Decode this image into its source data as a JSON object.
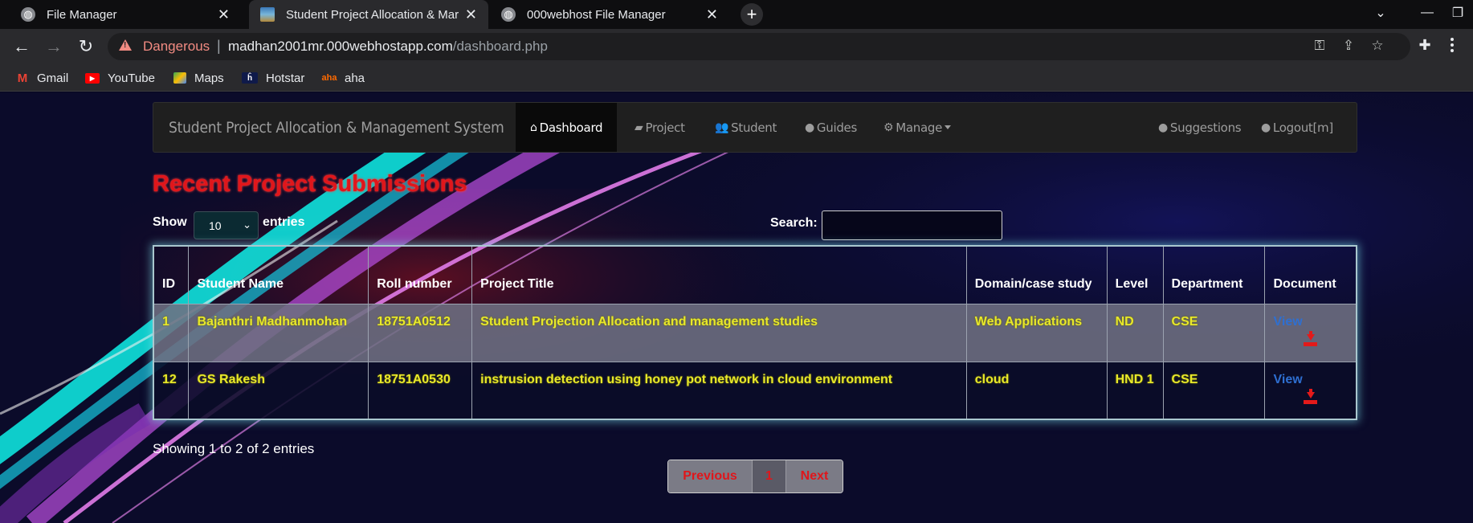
{
  "browser": {
    "tabs": [
      {
        "title": "File Manager",
        "active": false
      },
      {
        "title": "Student Project Allocation & Mar",
        "active": true
      },
      {
        "title": "000webhost File Manager",
        "active": false
      }
    ],
    "security_label": "Dangerous",
    "url_host": "madhan2001mr.000webhostapp.com",
    "url_path": "/dashboard.php",
    "bookmarks": [
      {
        "label": "Gmail",
        "icon": "gmail-icon"
      },
      {
        "label": "YouTube",
        "icon": "youtube-icon"
      },
      {
        "label": "Maps",
        "icon": "maps-icon"
      },
      {
        "label": "Hotstar",
        "icon": "hotstar-icon"
      },
      {
        "label": "aha",
        "icon": "aha-icon"
      }
    ]
  },
  "navbar": {
    "brand": "Student Project Allocation & Management System",
    "items": {
      "dashboard": "Dashboard",
      "project": "Project",
      "student": "Student",
      "guides": "Guides",
      "manage": "Manage",
      "suggestions": "Suggestions",
      "logout": "Logout[m]"
    }
  },
  "main": {
    "heading": "Recent Project Submissions",
    "show_label": "Show",
    "entries_value": "10",
    "entries_label": "entries",
    "search_label": "Search:",
    "search_value": ""
  },
  "table": {
    "headers": {
      "id": "ID",
      "student_name": "Student Name",
      "roll_number": "Roll number",
      "project_title": "Project Title",
      "domain": "Domain/case study",
      "level": "Level",
      "department": "Department",
      "document": "Document"
    },
    "rows": [
      {
        "id": "1",
        "student_name": "Bajanthri Madhanmohan",
        "roll_number": "18751A0512",
        "project_title": "Student Projection Allocation and management studies",
        "domain": "Web Applications",
        "level": "ND",
        "department": "CSE",
        "document": "View"
      },
      {
        "id": "12",
        "student_name": "GS Rakesh",
        "roll_number": "18751A0530",
        "project_title": "instrusion detection using honey pot network in cloud environment",
        "domain": "cloud",
        "level": "HND 1",
        "department": "CSE",
        "document": "View"
      }
    ]
  },
  "footer": {
    "info": "Showing 1 to 2 of 2 entries",
    "pagination": {
      "previous": "Previous",
      "current": "1",
      "next": "Next"
    }
  },
  "colors": {
    "heading": "#e0161b",
    "cell_text": "#e8e82a",
    "link": "#2e6fd1",
    "page_bg": "#0b0b2a"
  }
}
